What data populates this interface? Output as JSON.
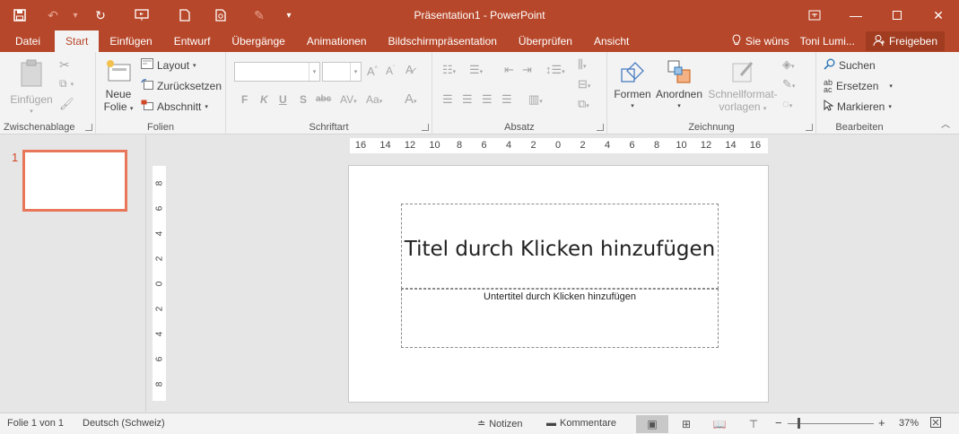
{
  "window": {
    "title": "Präsentation1 - PowerPoint"
  },
  "tabs": [
    {
      "label": "Datei"
    },
    {
      "label": "Start"
    },
    {
      "label": "Einfügen"
    },
    {
      "label": "Entwurf"
    },
    {
      "label": "Übergänge"
    },
    {
      "label": "Animationen"
    },
    {
      "label": "Bildschirmpräsentation"
    },
    {
      "label": "Überprüfen"
    },
    {
      "label": "Ansicht"
    }
  ],
  "tabs_right": {
    "tell_me": "Sie wüns",
    "user": "Toni Lumi...",
    "share": "Freigeben"
  },
  "ribbon": {
    "clipboard": {
      "label": "Zwischenablage",
      "paste": "Einfügen"
    },
    "slides": {
      "label": "Folien",
      "new_slide_line1": "Neue",
      "new_slide_line2": "Folie",
      "layout": "Layout",
      "reset": "Zurücksetzen",
      "section": "Abschnitt"
    },
    "font": {
      "label": "Schriftart",
      "bold": "F",
      "italic": "K",
      "underline": "U",
      "shadow": "S",
      "strike": "abc",
      "font_color": "A"
    },
    "paragraph": {
      "label": "Absatz"
    },
    "drawing": {
      "label": "Zeichnung",
      "shapes": "Formen",
      "arrange": "Anordnen",
      "quick_styles_line1": "Schnellformat-",
      "quick_styles_line2": "vorlagen"
    },
    "editing": {
      "label": "Bearbeiten",
      "find": "Suchen",
      "replace": "Ersetzen",
      "select": "Markieren"
    }
  },
  "thumbnails": {
    "number": "1"
  },
  "ruler": {
    "horizontal": [
      "16",
      "14",
      "12",
      "10",
      "8",
      "6",
      "4",
      "2",
      "0",
      "2",
      "4",
      "6",
      "8",
      "10",
      "12",
      "14",
      "16"
    ],
    "vertical": [
      "8",
      "6",
      "4",
      "2",
      "0",
      "2",
      "4",
      "6",
      "8"
    ]
  },
  "slide": {
    "title_placeholder": "Titel durch Klicken hinzufügen",
    "subtitle_placeholder": "Untertitel durch Klicken hinzufügen"
  },
  "statusbar": {
    "slide_info": "Folie 1 von 1",
    "language": "Deutsch (Schweiz)",
    "notes": "Notizen",
    "comments": "Kommentare",
    "zoom": "37%"
  },
  "colors": {
    "accent": "#b7472a",
    "active_tab_text": "#b7472a",
    "thumbnail_border": "#e8775a"
  }
}
